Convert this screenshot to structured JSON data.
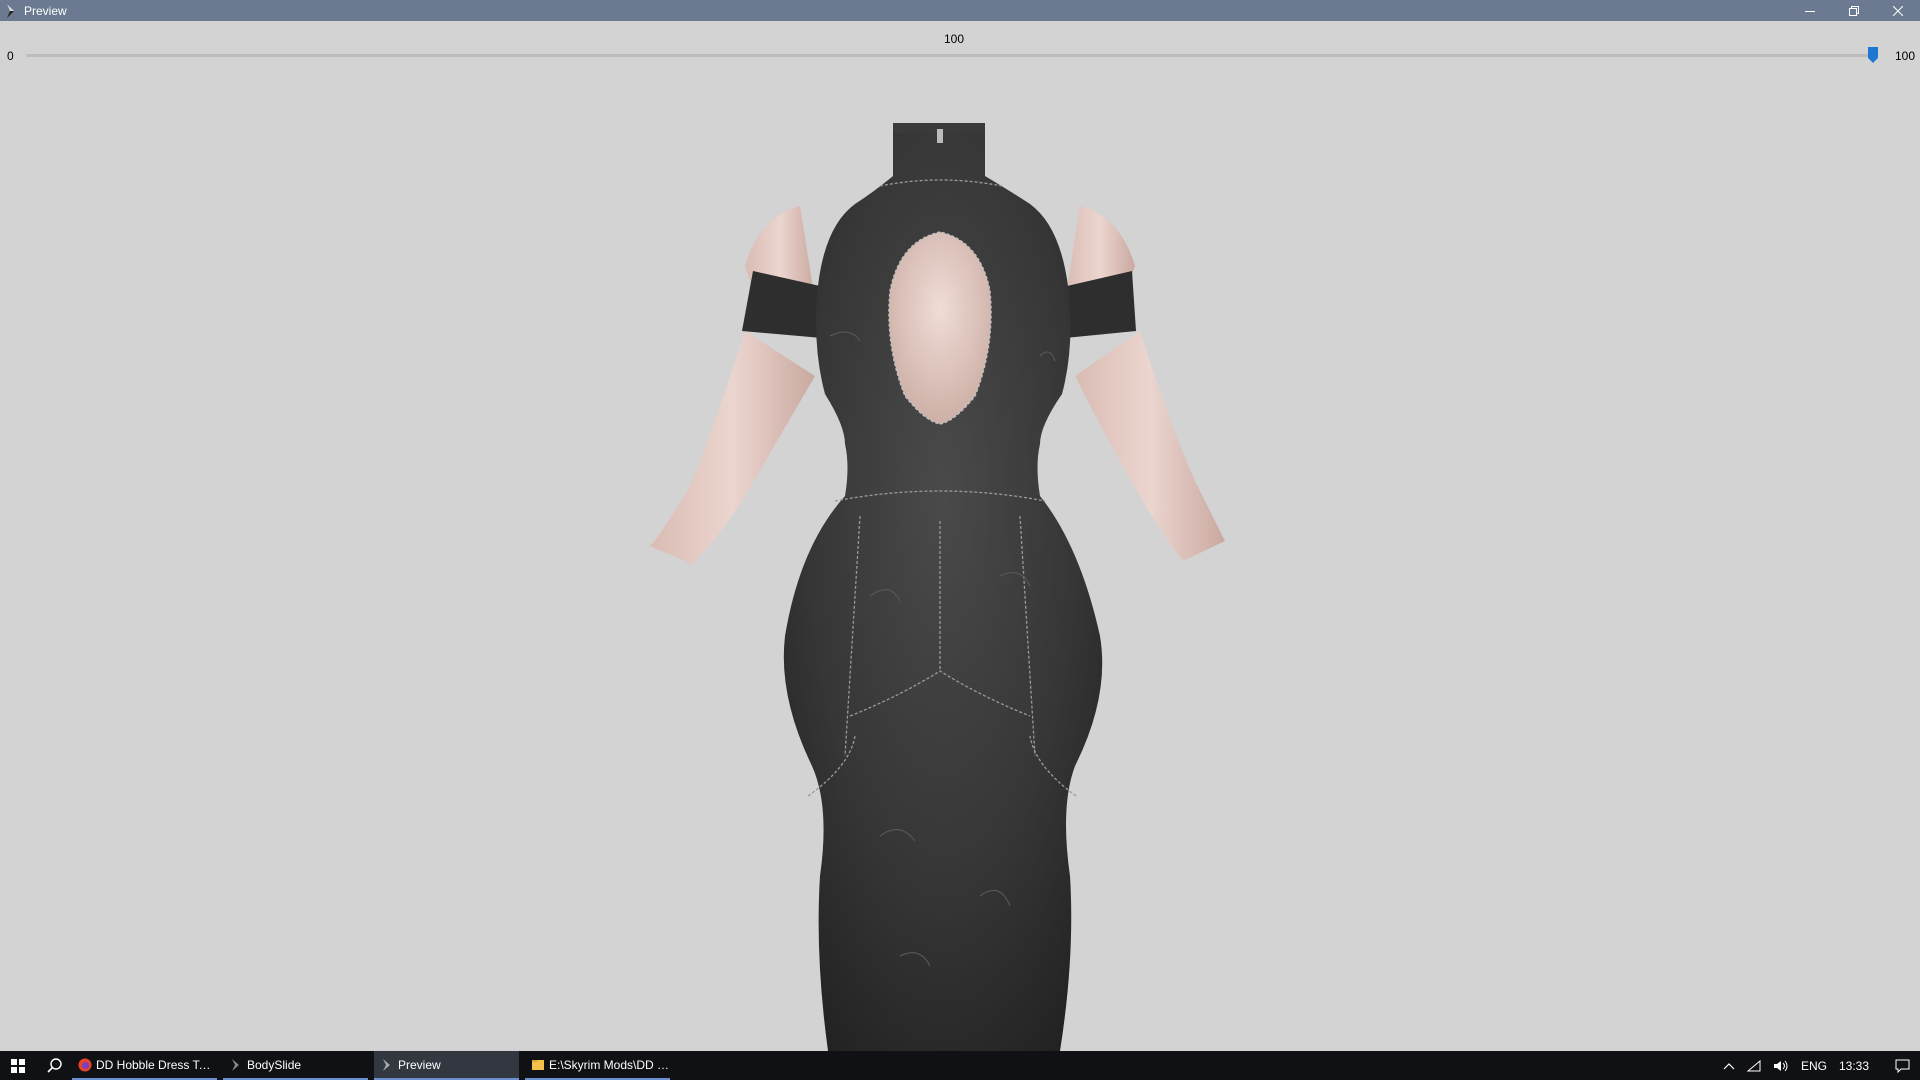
{
  "window": {
    "title": "Preview",
    "icon": "bodyslide-icon",
    "controls": [
      "minimize-icon",
      "restore-icon",
      "close-icon"
    ]
  },
  "slider": {
    "value": 100,
    "value_label": "100",
    "min_label": "0",
    "max_label": "100",
    "min": 0,
    "max": 100,
    "accent_color": "#1e78d2"
  },
  "viewport": {
    "background_color": "#d3d3d3",
    "model": "dress-on-body-preview"
  },
  "taskbar": {
    "items": [
      {
        "label": "DD Hobble Dress Text...",
        "icon": "firefox-icon",
        "active": false
      },
      {
        "label": "BodySlide",
        "icon": "bodyslide-icon",
        "active": false
      },
      {
        "label": "Preview",
        "icon": "bodyslide-icon",
        "active": true
      },
      {
        "label": "E:\\Skyrim Mods\\DD R...",
        "icon": "folder-icon",
        "active": false
      }
    ],
    "tray": {
      "language": "ENG",
      "time": "13:33"
    }
  }
}
